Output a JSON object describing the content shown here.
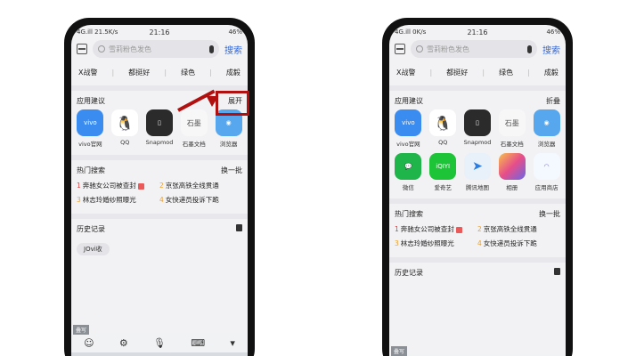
{
  "left": {
    "status": {
      "net": "4G.ill 21.5K/s",
      "time": "21:16",
      "battery": "46%"
    },
    "search": {
      "placeholder": "雪莉粉色发色",
      "button": "搜索"
    },
    "hotwords": [
      "X战警",
      "都挺好",
      "绿色",
      "成毅"
    ],
    "apps_section": {
      "title": "应用建议",
      "action": "展开"
    },
    "apps": [
      {
        "label": "vivo官网",
        "icon": "vivo-icon"
      },
      {
        "label": "QQ",
        "icon": "qq-icon"
      },
      {
        "label": "Snapmod",
        "icon": "snapmod-icon"
      },
      {
        "label": "石墨文档",
        "icon": "shimo-icon"
      },
      {
        "label": "浏览器",
        "icon": "browser-icon"
      }
    ],
    "hot_section": {
      "title": "热门搜索",
      "action": "换一批"
    },
    "hot": [
      {
        "n": "1",
        "text": "奔驰女公司被查封"
      },
      {
        "n": "2",
        "text": "京张高铁全线贯通"
      },
      {
        "n": "3",
        "text": "林志玲婚纱照曝光"
      },
      {
        "n": "4",
        "text": "女快递员投诉下跪"
      }
    ],
    "history_section": {
      "title": "历史记录"
    },
    "history": [
      "JOvi收"
    ],
    "keyboard_tag": "叠写"
  },
  "right": {
    "status": {
      "net": "4G.ill 0K/s",
      "time": "21:16",
      "battery": "46%"
    },
    "search": {
      "placeholder": "雪莉粉色发色",
      "button": "搜索"
    },
    "hotwords": [
      "X战警",
      "都挺好",
      "绿色",
      "成毅"
    ],
    "apps_section": {
      "title": "应用建议",
      "action": "折叠"
    },
    "apps": [
      {
        "label": "vivo官网",
        "icon": "vivo-icon"
      },
      {
        "label": "QQ",
        "icon": "qq-icon"
      },
      {
        "label": "Snapmod",
        "icon": "snapmod-icon"
      },
      {
        "label": "石墨文档",
        "icon": "shimo-icon"
      },
      {
        "label": "浏览器",
        "icon": "browser-icon"
      },
      {
        "label": "微信",
        "icon": "wechat-icon"
      },
      {
        "label": "爱奇艺",
        "icon": "iqiyi-icon"
      },
      {
        "label": "腾讯地图",
        "icon": "map-icon"
      },
      {
        "label": "相册",
        "icon": "album-icon"
      },
      {
        "label": "应用商店",
        "icon": "store-icon"
      }
    ],
    "hot_section": {
      "title": "热门搜索",
      "action": "换一批"
    },
    "hot": [
      {
        "n": "1",
        "text": "奔驰女公司被查封"
      },
      {
        "n": "2",
        "text": "京张高铁全线贯通"
      },
      {
        "n": "3",
        "text": "林志玲婚纱照曝光"
      },
      {
        "n": "4",
        "text": "女快递员投诉下跪"
      }
    ],
    "history_section": {
      "title": "历史记录"
    },
    "keyboard_tag": "叠写"
  },
  "colors": {
    "accent": "#3469d8",
    "annotation": "#b01010"
  }
}
